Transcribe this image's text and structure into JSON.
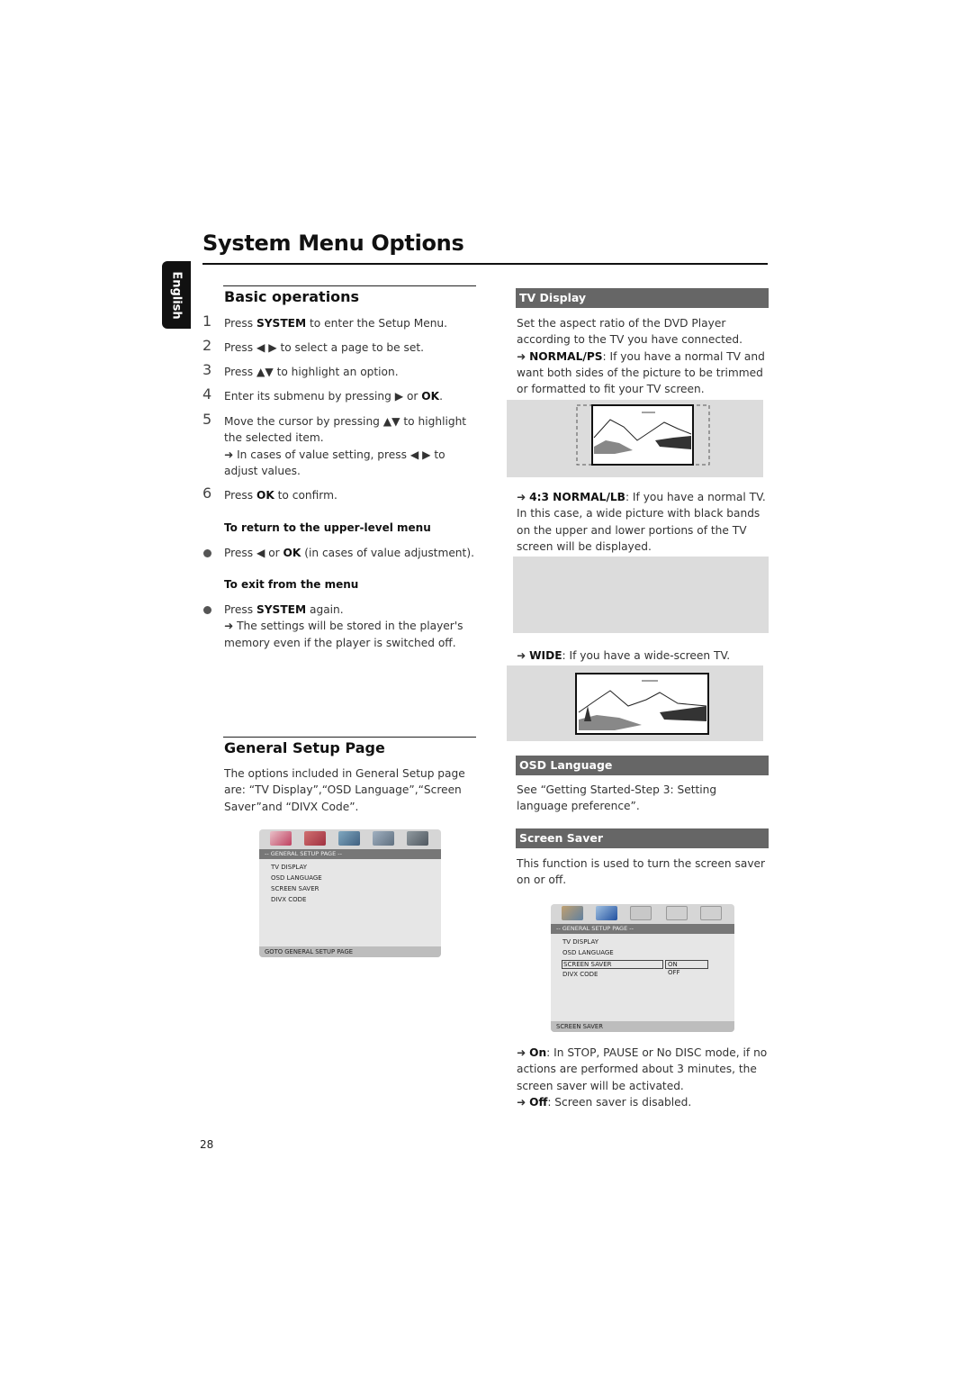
{
  "page": {
    "title": "System Menu Options",
    "language_tab": "English",
    "page_number": "28"
  },
  "basic_operations": {
    "heading": "Basic operations",
    "steps": [
      {
        "num": "1",
        "pre": "Press ",
        "bold": "SYSTEM",
        "post": " to enter the Setup Menu."
      },
      {
        "num": "2",
        "pre": "Press ◀ ▶ to select a page to be set.",
        "bold": "",
        "post": ""
      },
      {
        "num": "3",
        "pre": "Press ▲▼  to highlight an option.",
        "bold": "",
        "post": ""
      },
      {
        "num": "4",
        "pre": "Enter its submenu by pressing ▶ or ",
        "bold": "OK",
        "post": "."
      },
      {
        "num": "5",
        "pre": "Move the cursor by pressing ▲▼  to highlight the selected item.",
        "bold": "",
        "post": "",
        "note": "➜ In cases of value setting, press ◀ ▶ to adjust values."
      },
      {
        "num": "6",
        "pre": "Press ",
        "bold": "OK",
        "post": " to confirm."
      }
    ],
    "return_heading": "To return to the upper-level menu",
    "return_bullet": {
      "pre": "Press ◀ or ",
      "bold": "OK",
      "post": " (in cases of value adjustment)."
    },
    "exit_heading": "To exit from the menu",
    "exit_bullet": {
      "pre": "Press ",
      "bold": "SYSTEM",
      "post": " again.",
      "note": "➜ The settings will be stored in the player's memory even if the player is switched off."
    }
  },
  "general_setup": {
    "heading": "General Setup Page",
    "intro": "The options included in General Setup page are: “TV Display”,“OSD Language”,“Screen Saver”and  “DIVX Code”.",
    "osd_screen_1": {
      "header": "-- GENERAL SETUP PAGE --",
      "items": [
        "TV DISPLAY",
        "OSD LANGUAGE",
        "SCREEN SAVER",
        "DIVX CODE"
      ],
      "footer": "GOTO GENERAL SETUP PAGE"
    }
  },
  "tv_display": {
    "bar_label": "TV Display",
    "intro": "Set the aspect ratio of the DVD Player according to the TV you have connected.",
    "normal_ps": {
      "arrow": "➜",
      "bold": "NORMAL/PS",
      "text": ": If you have a normal TV and want both sides of the picture to be trimmed or formatted to fit your TV screen."
    },
    "normal_lb": {
      "arrow": "➜",
      "bold": "4:3 NORMAL/LB",
      "text": ": If you have a normal TV. In this case, a wide picture with black bands on the upper and lower portions of the TV screen will be displayed."
    },
    "wide": {
      "arrow": "➜",
      "bold": "WIDE",
      "text": ": If you have a wide-screen TV."
    }
  },
  "osd_language": {
    "bar_label": "OSD Language",
    "text": "See “Getting Started-Step 3: Setting language preference”."
  },
  "screen_saver": {
    "bar_label": "Screen Saver",
    "text": "This function is used to turn the screen saver on or off.",
    "osd_screen_2": {
      "header": "-- GENERAL SETUP PAGE --",
      "items": [
        "TV DISPLAY",
        "OSD LANGUAGE",
        "SCREEN SAVER",
        "DIVX CODE"
      ],
      "options": [
        "ON",
        "OFF"
      ],
      "selected_item": "SCREEN SAVER",
      "selected_option": "ON",
      "footer": "SCREEN SAVER"
    },
    "on": {
      "arrow": "➜",
      "bold": "On",
      "text": ": In STOP, PAUSE or No DISC mode, if no actions are performed about 3 minutes, the screen saver will be activated."
    },
    "off": {
      "arrow": "➜",
      "bold": "Off",
      "text": ": Screen saver is disabled."
    }
  },
  "colors": {
    "bar_bg": "#666666",
    "figure_bg": "#dcdcdc",
    "tab_bg": "#111111"
  }
}
